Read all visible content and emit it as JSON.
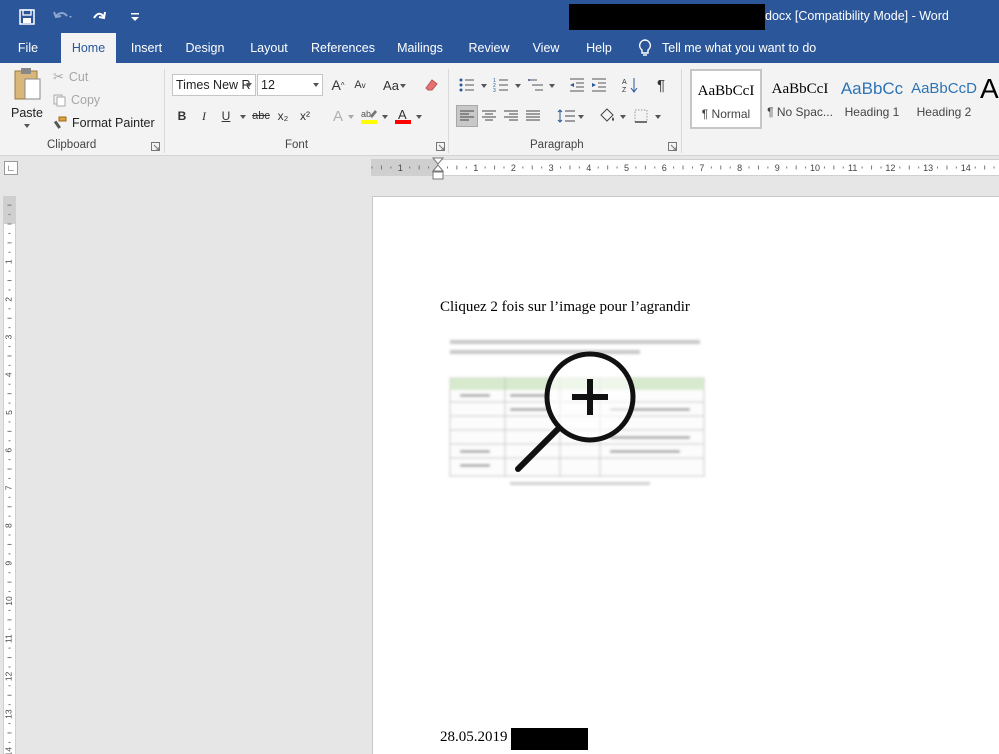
{
  "window": {
    "title": "docx [Compatibility Mode]  -  Word"
  },
  "tabs": [
    "File",
    "Home",
    "Insert",
    "Design",
    "Layout",
    "References",
    "Mailings",
    "Review",
    "View",
    "Help"
  ],
  "active_tab": "Home",
  "tell_me": "Tell me what you want to do",
  "clipboard": {
    "paste": "Paste",
    "cut": "Cut",
    "copy": "Copy",
    "format_painter": "Format Painter",
    "label": "Clipboard"
  },
  "font": {
    "name": "Times New R",
    "size": "12",
    "grow": "A",
    "shrink": "A",
    "case": "Aa",
    "bold": "B",
    "italic": "I",
    "underline": "U",
    "strike": "abc",
    "subscript": "x₂",
    "superscript": "x²",
    "label": "Font",
    "highlight_color": "#ffff00",
    "font_color": "#ff0000"
  },
  "paragraph": {
    "label": "Paragraph",
    "pilcrow": "¶"
  },
  "styles": [
    {
      "sample": "AaBbCcI",
      "label": "¶ Normal"
    },
    {
      "sample": "AaBbCcI",
      "label": "¶ No Spac..."
    },
    {
      "sample": "AaBbCc",
      "label": "Heading 1"
    },
    {
      "sample": "AaBbCcD",
      "label": "Heading 2"
    },
    {
      "sample": "A",
      "label": ""
    }
  ],
  "ruler": {
    "h_numbers": [
      "1",
      "1",
      "2",
      "3",
      "4",
      "5",
      "6",
      "7",
      "8",
      "9",
      "10",
      "11",
      "12",
      "13",
      "14"
    ],
    "v_numbers": [
      "1",
      "1",
      "2",
      "3",
      "4",
      "5",
      "6",
      "7",
      "8",
      "9",
      "10",
      "11",
      "12",
      "13",
      "14"
    ]
  },
  "document": {
    "line1": "Cliquez 2 fois sur l’image pour l’agrandir",
    "date": "28.05.2019"
  },
  "colors": {
    "brand": "#2b579a",
    "ribbon": "#f3f3f3",
    "workspace": "#e6e6e6"
  }
}
